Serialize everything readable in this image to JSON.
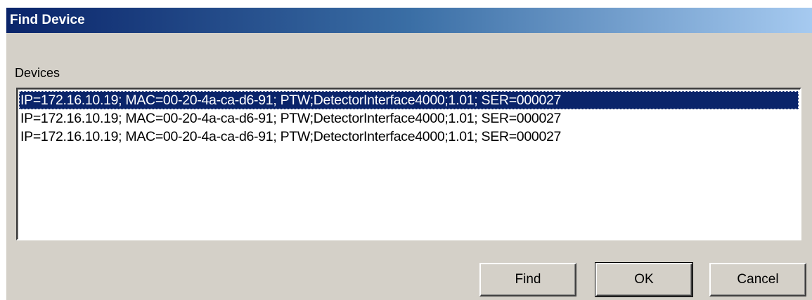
{
  "window": {
    "title": "Find Device"
  },
  "devices": {
    "label": "Devices",
    "items": [
      "IP=172.16.10.19; MAC=00-20-4a-ca-d6-91; PTW;DetectorInterface4000;1.01; SER=000027",
      "IP=172.16.10.19; MAC=00-20-4a-ca-d6-91; PTW;DetectorInterface4000;1.01; SER=000027",
      "IP=172.16.10.19; MAC=00-20-4a-ca-d6-91; PTW;DetectorInterface4000;1.01; SER=000027"
    ],
    "selected_index": 0
  },
  "buttons": {
    "find": "Find",
    "ok": "OK",
    "cancel": "Cancel"
  },
  "colors": {
    "selection": "#0a246a",
    "dialog_face": "#d4d0c8"
  }
}
